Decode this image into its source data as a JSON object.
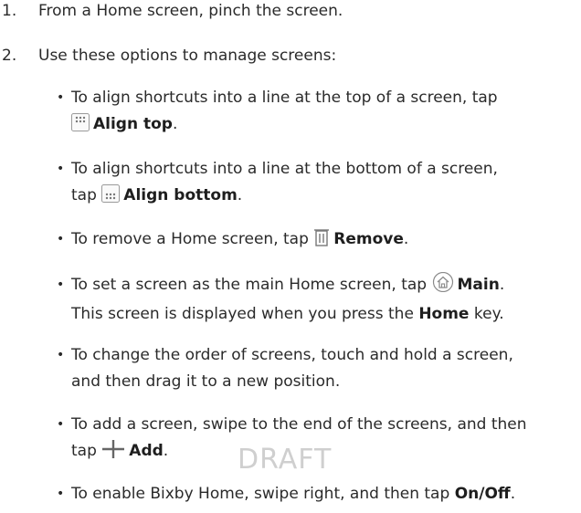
{
  "steps": [
    {
      "num": "1.",
      "text": "From a Home screen, pinch the screen."
    },
    {
      "num": "2.",
      "text": "Use these options to manage screens:"
    }
  ],
  "bullets": {
    "align_top": {
      "pre": "To align shortcuts into a line at the top of a screen, tap",
      "icon": "align-top-icon",
      "label": "Align top",
      "post": "."
    },
    "align_bottom": {
      "pre": "To align shortcuts into a line at the bottom of a screen,",
      "pre2": "tap",
      "icon": "align-bottom-icon",
      "label": "Align bottom",
      "post": "."
    },
    "remove": {
      "pre": "To remove a Home screen, tap",
      "icon": "trash-icon",
      "label": "Remove",
      "post": "."
    },
    "main": {
      "pre": "To set a screen as the main Home screen, tap",
      "icon": "home-icon",
      "label": "Main",
      "post": ".",
      "line2_pre": "This screen is displayed when you press the",
      "line2_bold": "Home",
      "line2_post": "key."
    },
    "reorder": {
      "line1": "To change the order of screens, touch and hold a screen,",
      "line2": "and then drag it to a new position."
    },
    "add": {
      "pre": "To add a screen, swipe to the end of the screens, and then",
      "pre2": "tap",
      "icon": "plus-icon",
      "label": "Add",
      "post": "."
    },
    "bixby": {
      "pre": "To enable Bixby Home, swipe right, and then tap",
      "label": "On/Off",
      "post": "."
    }
  },
  "bullet_symbol": "•",
  "watermark": "DRAFT"
}
